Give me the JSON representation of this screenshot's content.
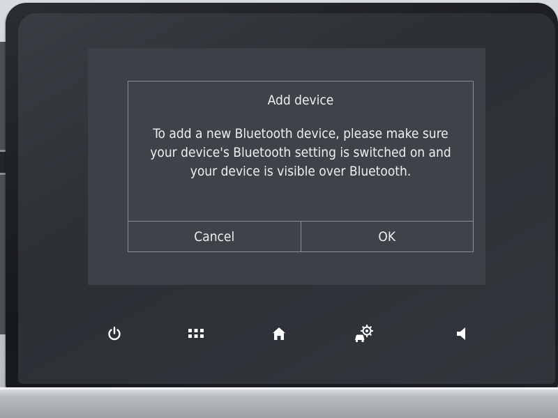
{
  "dialog": {
    "title": "Add device",
    "message": "To add a new Bluetooth device, please make sure\nyour device's Bluetooth setting is switched on and\nyour device is visible over Bluetooth.",
    "cancel_label": "Cancel",
    "ok_label": "OK"
  },
  "softkeys": [
    {
      "icon": "power-icon"
    },
    {
      "icon": "apps-grid-icon"
    },
    {
      "icon": "home-icon"
    },
    {
      "icon": "vehicle-settings-icon"
    },
    {
      "icon": "volume-icon"
    }
  ],
  "colors": {
    "screen_bg": "#2c2f34",
    "dialog_bg": "#3f4248",
    "dialog_border": "#8a8d92",
    "text": "#eef0f2"
  }
}
